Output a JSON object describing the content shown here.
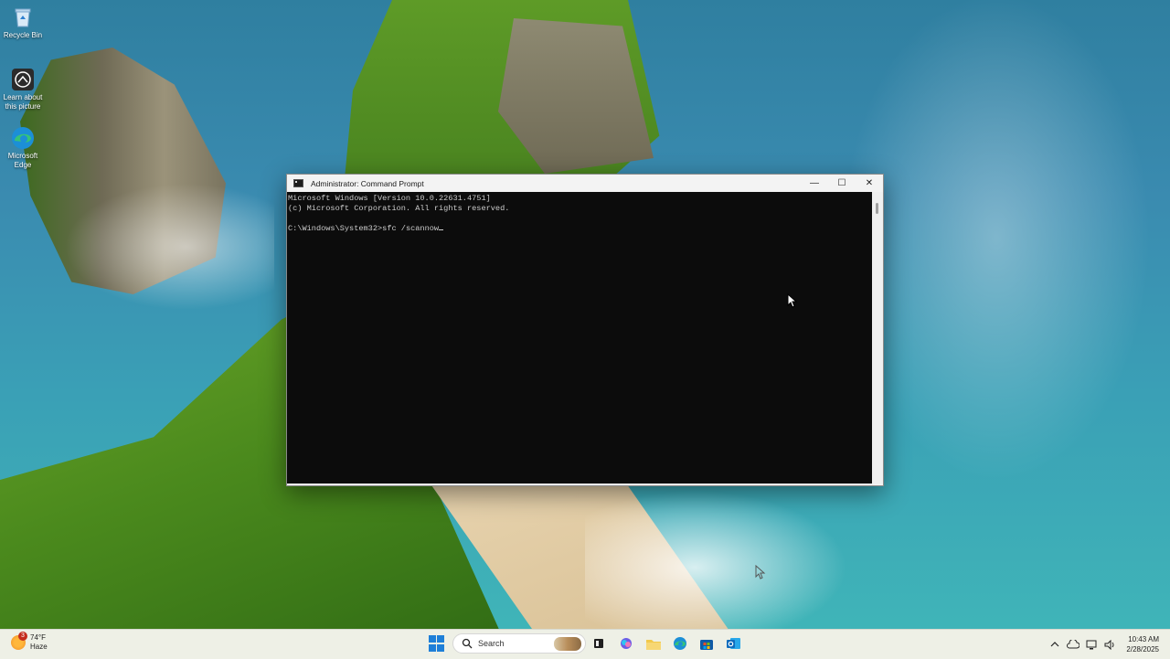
{
  "desktop": {
    "icons": [
      {
        "label": "Recycle Bin",
        "icon": "recycle-bin-icon"
      },
      {
        "label": "Learn about this picture",
        "icon": "learn-about-picture-icon"
      },
      {
        "label": "Microsoft Edge",
        "icon": "edge-icon"
      }
    ]
  },
  "cmd": {
    "title": "Administrator: Command Prompt",
    "controls": {
      "minimize": "—",
      "maximize": "☐",
      "close": "✕"
    },
    "lines": [
      "Microsoft Windows [Version 10.0.22631.4751]",
      "(c) Microsoft Corporation. All rights reserved.",
      ""
    ],
    "prompt": "C:\\Windows\\System32>",
    "command": "sfc /scannow"
  },
  "taskbar": {
    "weather": {
      "temp": "74°F",
      "condition": "Haze",
      "badge": "3"
    },
    "search_label": "Search",
    "pinned": [
      "task-view-icon",
      "copilot-icon",
      "file-explorer-icon",
      "edge-icon",
      "microsoft-store-icon",
      "outlook-icon"
    ],
    "tray": {
      "time": "10:43 AM",
      "date": "2/28/2025"
    }
  },
  "colors": {
    "console_bg": "#0c0c0c",
    "console_text": "#cccccc",
    "accent": "#1e7fd8"
  }
}
